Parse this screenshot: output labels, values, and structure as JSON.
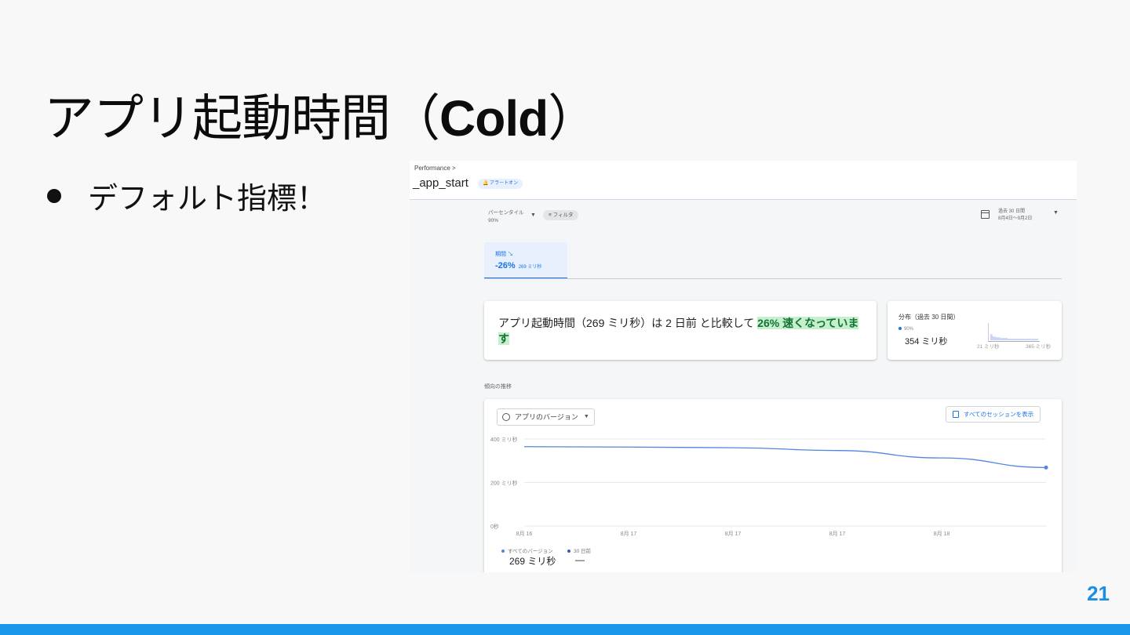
{
  "slide": {
    "title_jp": "アプリ起動時間（",
    "title_bold": "Cold",
    "title_end": "）",
    "bullet": "デフォルト指標！",
    "page_number": "21",
    "accent_color": "#1a96ea"
  },
  "header": {
    "breadcrumb": "Performance >",
    "trace_name": "_app_start",
    "alert_chip": "アラートオン"
  },
  "controls": {
    "percentile_label": "パーセンタイル",
    "percentile_value": "90%",
    "filter_label": "フィルタ",
    "date_range_title": "過去 30 日間",
    "date_range_detail": "8月4日〜9月2日",
    "calendar_icon": "calendar-icon"
  },
  "metric_tab": {
    "label": "期間 ↘",
    "value": "-26%",
    "sub": "269 ミリ秒"
  },
  "insight": {
    "text_before": "アプリ起動時間（269 ミリ秒）は 2 日前 と比較して ",
    "highlight": "26% 速くなっています"
  },
  "distribution": {
    "title": "分布（過去 30 日間）",
    "percentile": "90%",
    "value": "354 ミリ秒",
    "range_low": "21 ミリ秒",
    "range_high": "365 ミリ秒"
  },
  "trend": {
    "section_label": "傾向の推移",
    "version_select": "アプリのバージョン",
    "sessions_button": "すべてのセッションを表示",
    "legend": [
      {
        "label": "すべてのバージョン",
        "value": "269 ミリ秒",
        "color": "#4f86e0"
      },
      {
        "label": "30 日前",
        "value": "—",
        "color": "#3b5bb5"
      }
    ]
  },
  "chart_data": {
    "type": "line",
    "x_ticks": [
      "8月 16",
      "8月 17",
      "8月 17",
      "8月 17",
      "8月 18"
    ],
    "y_ticks": [
      {
        "value": 400,
        "label": "400 ミリ秒"
      },
      {
        "value": 200,
        "label": "200 ミリ秒"
      },
      {
        "value": 0,
        "label": "0秒"
      }
    ],
    "ylim": [
      0,
      400
    ],
    "series": [
      {
        "name": "すべてのバージョン",
        "color": "#4f86e0",
        "x": [
          0,
          1,
          2,
          3,
          4,
          5
        ],
        "values": [
          365,
          363,
          360,
          347,
          313,
          269
        ]
      }
    ],
    "grid": true
  }
}
